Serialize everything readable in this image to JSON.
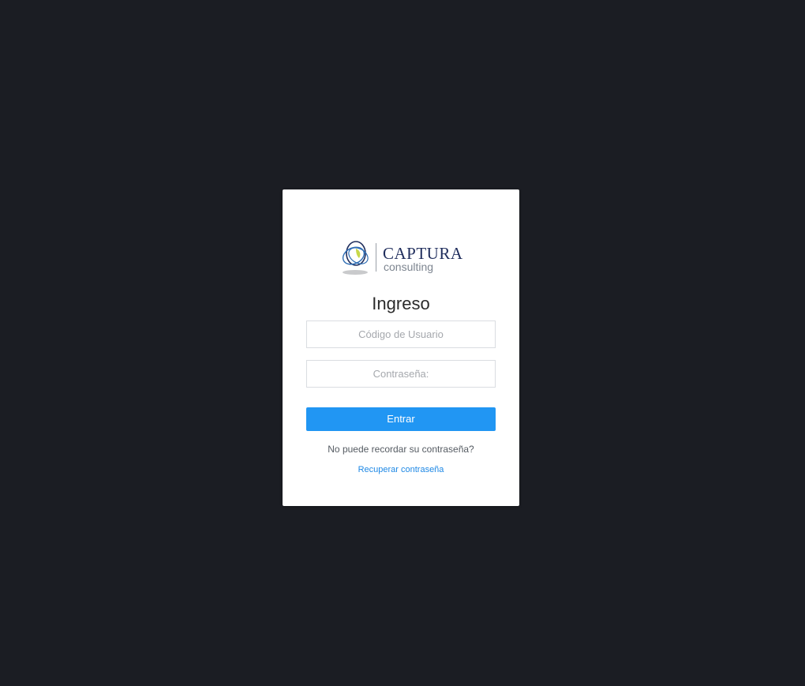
{
  "brand": {
    "name": "CAPTURA",
    "subtitle": "consulting",
    "colors": {
      "navy": "#1f2d5c",
      "blue": "#2e6db4",
      "lime": "#c8d84a",
      "gray": "#7d8590"
    },
    "icon": "captura-logo-icon"
  },
  "login": {
    "title": "Ingreso",
    "username_placeholder": "Código de Usuario",
    "password_placeholder": "Contraseña:",
    "submit_label": "Entrar",
    "forgot_text": "No puede recordar su contraseña?",
    "recover_label": "Recuperar contraseña"
  },
  "theme": {
    "background": "#1b1d23",
    "card": "#ffffff",
    "accent": "#2196f3",
    "link": "#1e88e5"
  }
}
